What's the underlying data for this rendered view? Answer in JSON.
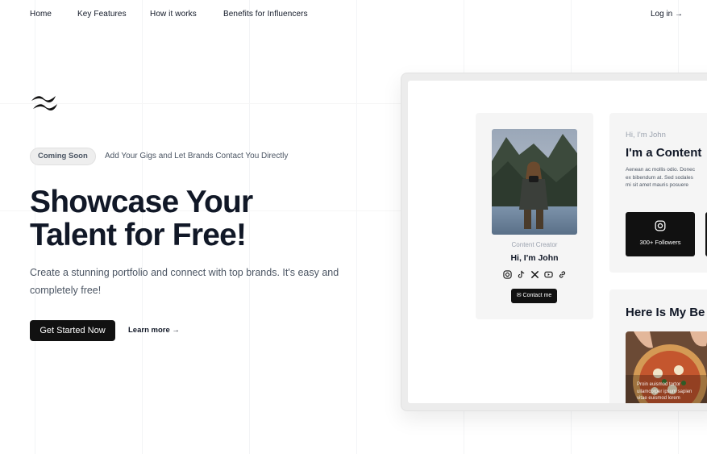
{
  "nav": {
    "links": [
      "Home",
      "Key Features",
      "How it works",
      "Benefits for Influencers"
    ],
    "login": "Log in →"
  },
  "logo": {
    "icon": "tailwind-wave-icon"
  },
  "hero": {
    "badge": "Coming Soon",
    "badge_note": "Add Your Gigs and Let Brands Contact You Directly",
    "title": "Showcase Your Talent for Free!",
    "subtitle": "Create a stunning portfolio and connect with top brands. It's easy and completely free!",
    "cta_primary": "Get Started Now",
    "cta_secondary": "Learn more →"
  },
  "mockup": {
    "profile": {
      "role": "Content Creator",
      "name": "Hi, I'm John",
      "socials": [
        "instagram-icon",
        "tiktok-icon",
        "x-icon",
        "youtube-icon",
        "link-icon"
      ],
      "contact": "Contact me"
    },
    "intro": {
      "greeting": "Hi, I'm John",
      "title": "I'm a Content",
      "body": "Aenean ac mollis odio. Donec\nex bibendum at. Sed sodales\nmi sit amet mauris posuere",
      "stat": "300+ Followers"
    },
    "best": {
      "title": "Here Is My Be",
      "caption": "Proin euismod tortor\nullamcorper ipsum sapien\nvitae euismod lorem"
    }
  },
  "colors": {
    "accent": "#111111",
    "muted": "#4b5563",
    "card": "#f5f5f5"
  }
}
